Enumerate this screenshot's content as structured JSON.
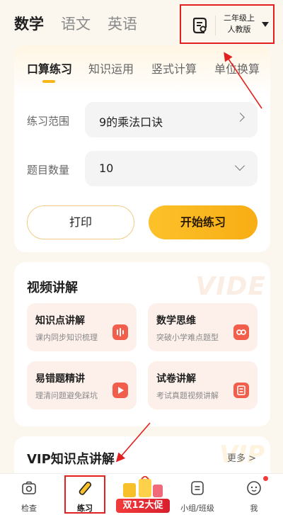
{
  "subjects": [
    "数学",
    "语文",
    "英语"
  ],
  "grade": {
    "line1": "二年级上",
    "line2": "人教版"
  },
  "tabs": [
    "口算练习",
    "知识运用",
    "竖式计算",
    "单位换算"
  ],
  "form": {
    "range_label": "练习范围",
    "range_value": "9的乘法口诀",
    "count_label": "题目数量",
    "count_value": "10"
  },
  "buttons": {
    "print": "打印",
    "start": "开始练习"
  },
  "video": {
    "title": "视频讲解",
    "watermark": "VIDE",
    "tiles": [
      {
        "title": "知识点讲解",
        "subtitle": "课内同步知识梳理",
        "icon": "audio-wave-icon"
      },
      {
        "title": "数学思维",
        "subtitle": "突破小学难点题型",
        "icon": "infinity-icon"
      },
      {
        "title": "易错题精讲",
        "subtitle": "理清问题避免踩坑",
        "icon": "play-icon"
      },
      {
        "title": "试卷讲解",
        "subtitle": "考试真题视频讲解",
        "icon": "document-icon"
      }
    ]
  },
  "vip": {
    "title": "VIP知识点讲解",
    "more": "更多 >",
    "watermark": "VIP"
  },
  "tabbar": {
    "check": "检查",
    "practice": "练习",
    "promo": "双12大促",
    "group": "小组/班级",
    "me": "我"
  },
  "colors": {
    "accent": "#f8ad14",
    "annotation": "#e32020",
    "tile_icon": "#f25e4c"
  }
}
